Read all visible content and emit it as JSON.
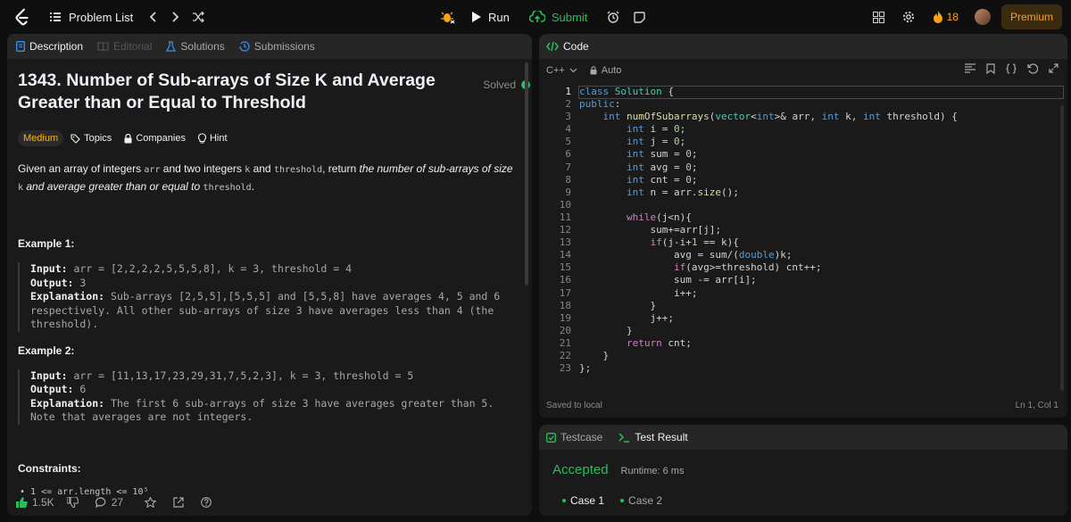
{
  "topbar": {
    "problem_list": "Problem List",
    "run": "Run",
    "submit": "Submit",
    "streak": "18",
    "premium": "Premium"
  },
  "left_tabs": [
    "Description",
    "Editorial",
    "Solutions",
    "Submissions"
  ],
  "problem": {
    "title": "1343. Number of Sub-arrays of Size K and Average Greater than or Equal to Threshold",
    "solved": "Solved",
    "difficulty": "Medium",
    "topics": "Topics",
    "companies": "Companies",
    "hint": "Hint",
    "statement": {
      "p1": "Given an array of integers ",
      "c1": "arr",
      "p2": " and two integers ",
      "c2": "k",
      "p3": " and ",
      "c3": "threshold",
      "p4": ", return ",
      "i1": "the number of sub-arrays of size ",
      "c4": "k",
      "i2": " and average greater than or equal to ",
      "c5": "threshold",
      "p5": "."
    },
    "example1": {
      "title": "Example 1:",
      "input_label": "Input:",
      "input": " arr = [2,2,2,2,5,5,5,8], k = 3, threshold = 4",
      "output_label": "Output:",
      "output": " 3",
      "explanation_label": "Explanation:",
      "explanation": " Sub-arrays [2,5,5],[5,5,5] and [5,5,8] have averages 4, 5 and 6 respectively. All other sub-arrays of size 3 have averages less than 4 (the threshold)."
    },
    "example2": {
      "title": "Example 2:",
      "input_label": "Input:",
      "input": " arr = [11,13,17,23,29,31,7,5,2,3], k = 3, threshold = 5",
      "output_label": "Output:",
      "output": " 6",
      "explanation_label": "Explanation:",
      "explanation": " The first 6 sub-arrays of size 3 have averages greater than 5. Note that averages are not integers."
    },
    "constraints_title": "Constraints:",
    "constraint1": "1 <= arr.length <= 10⁵"
  },
  "footer": {
    "likes": "1.5K",
    "comments": "27"
  },
  "code": {
    "tab": "Code",
    "language": "C++",
    "auto": "Auto",
    "saved": "Saved to local",
    "cursor": "Ln 1, Col 1",
    "lines": [
      "1",
      "2",
      "3",
      "4",
      "5",
      "6",
      "7",
      "8",
      "9",
      "10",
      "11",
      "12",
      "13",
      "14",
      "15",
      "16",
      "17",
      "18",
      "19",
      "20",
      "21",
      "22",
      "23"
    ]
  },
  "result": {
    "testcase_tab": "Testcase",
    "result_tab": "Test Result",
    "status": "Accepted",
    "runtime": "Runtime: 6 ms",
    "case1": "Case 1",
    "case2": "Case 2"
  },
  "colors": {
    "accent": "#ffa116",
    "green": "#2cbb5d",
    "medium": "#ffb800"
  }
}
